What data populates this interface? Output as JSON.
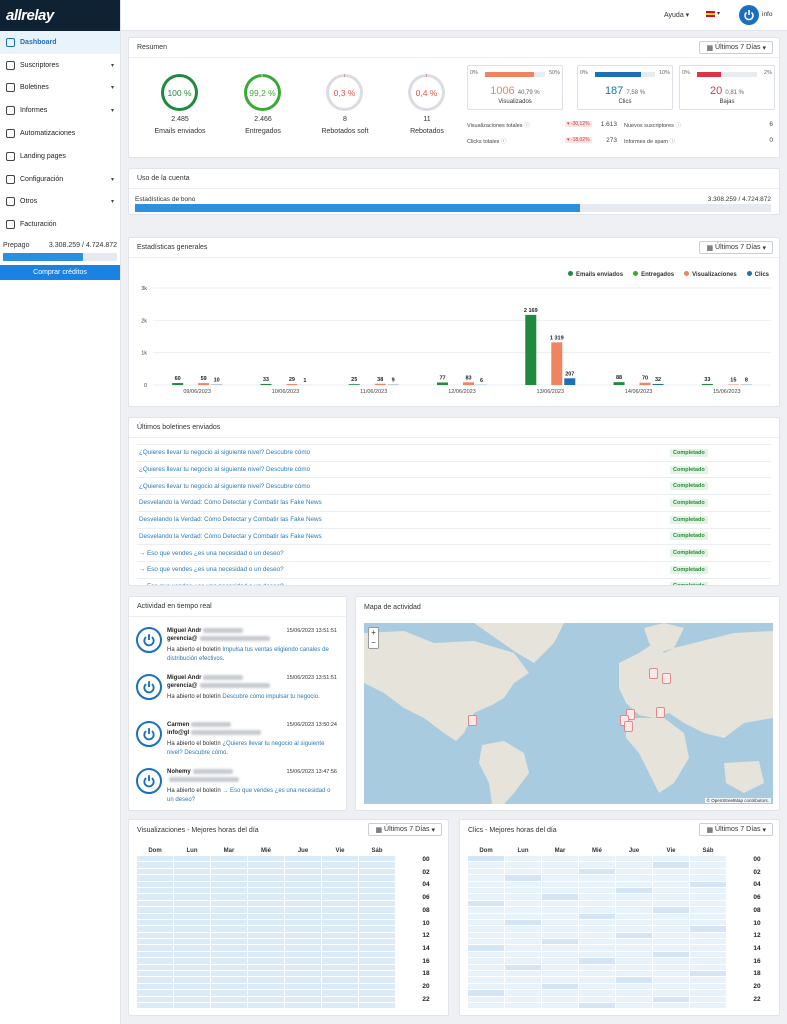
{
  "brand": {
    "logo_text": "allrelay"
  },
  "topbar": {
    "help": "Ayuda",
    "user": "info"
  },
  "sidebar": {
    "items": [
      {
        "label": "Dashboard",
        "icon": "grid-icon",
        "chevron": false,
        "active": true
      },
      {
        "label": "Suscriptores",
        "icon": "users-icon",
        "chevron": true
      },
      {
        "label": "Boletines",
        "icon": "mail-icon",
        "chevron": true
      },
      {
        "label": "Informes",
        "icon": "chart-icon",
        "chevron": true
      },
      {
        "label": "Automatizaciones",
        "icon": "automation-icon",
        "chevron": false
      },
      {
        "label": "Landing pages",
        "icon": "page-icon",
        "chevron": false
      },
      {
        "label": "Configuración",
        "icon": "gear-icon",
        "chevron": true
      },
      {
        "label": "Otros",
        "icon": "settings-icon",
        "chevron": true
      },
      {
        "label": "Facturación",
        "icon": "dollar-icon",
        "chevron": false
      }
    ],
    "prepago_label": "Prepago",
    "prepago_value": "3.308.259 / 4.724.872",
    "prepago_fraction": 0.7,
    "buy_label": "Comprar créditos"
  },
  "resumen": {
    "title": "Resumen",
    "period": "Últimos 7 Días",
    "rings": [
      {
        "value": "100 %",
        "count": "2.485",
        "label": "Emails enviados",
        "color": "#1f8a3b",
        "fraction": 1.0
      },
      {
        "value": "99,2 %",
        "count": "2.466",
        "label": "Entregados",
        "color": "#3aaa35",
        "fraction": 0.992
      },
      {
        "value": "0,3 %",
        "count": "8",
        "label": "Rebotados soft",
        "color": "#e0534a",
        "fraction": 0.003
      },
      {
        "value": "0,4 %",
        "count": "11",
        "label": "Rebotados",
        "color": "#e0534a",
        "fraction": 0.004
      }
    ],
    "boxes": [
      {
        "left": "0%",
        "right": "50%",
        "value": "1006",
        "pct": "40,79 %",
        "label": "Visualizados",
        "color": "#ef8460",
        "fill": 0.82,
        "text_color": "#ef8460"
      },
      {
        "left": "0%",
        "right": "10%",
        "value": "187",
        "pct": "7,58 %",
        "label": "Clics",
        "color": "#1f6fb5",
        "fill": 0.76,
        "text_color": "#1f6fb5"
      },
      {
        "left": "0%",
        "right": "2%",
        "value": "20",
        "pct": "0,81 %",
        "label": "Bajas",
        "color": "#d9364a",
        "fill": 0.4,
        "text_color": "#d9364a"
      }
    ],
    "stats": [
      {
        "label": "Visualizaciones totales",
        "delta": "-30,12%",
        "value": "1.613"
      },
      {
        "label": "Clicks totales",
        "delta": "-18,02%",
        "value": "273"
      }
    ],
    "stats_right": [
      {
        "label": "Nuevos suscriptores",
        "value": "6"
      },
      {
        "label": "Informes de spam",
        "value": "0"
      }
    ]
  },
  "uso": {
    "title": "Uso de la cuenta",
    "label": "Estadísticas de bono",
    "value": "3.308.259 / 4.724.872",
    "fraction": 0.7
  },
  "estadisticas": {
    "title": "Estadísticas generales",
    "period": "Últimos 7 Días"
  },
  "chart_data": {
    "type": "bar",
    "title": "",
    "ylim": [
      0,
      3000
    ],
    "yticks": [
      "0",
      "1k",
      "2k",
      "3k"
    ],
    "categories": [
      "09/06/2023",
      "10/06/2023",
      "11/06/2023",
      "12/06/2023",
      "13/06/2023",
      "14/06/2023",
      "15/06/2023"
    ],
    "series": [
      {
        "name": "Emails enviados",
        "color": "#1f8a3b",
        "values": [
          60,
          33,
          25,
          77,
          2169,
          88,
          33
        ],
        "labels": [
          "60",
          "33",
          "25",
          "77",
          "2 169",
          "88",
          "33"
        ]
      },
      {
        "name": "Entregados",
        "color": "#3aaa35",
        "values": [
          0,
          0,
          0,
          0,
          0,
          0,
          0
        ],
        "labels": [
          "",
          "",
          "",
          "",
          "",
          "",
          ""
        ]
      },
      {
        "name": "Visualizaciones",
        "color": "#ef8460",
        "values": [
          59,
          29,
          38,
          83,
          1319,
          70,
          15
        ],
        "labels": [
          "59",
          "29",
          "38",
          "83",
          "1 319",
          "70",
          "15"
        ]
      },
      {
        "name": "Clics",
        "color": "#1f6fb5",
        "values": [
          10,
          1,
          9,
          6,
          207,
          32,
          8
        ],
        "labels": [
          "10",
          "1",
          "9",
          "6",
          "207",
          "32",
          "8"
        ]
      }
    ],
    "legend": "top-right"
  },
  "boletines": {
    "title": "Últimos boletines enviados",
    "status": "Completado",
    "rows": [
      "¿Quieres llevar tu negocio al siguiente nivel? Descubre cómo",
      "¿Quieres llevar tu negocio al siguiente nivel? Descubre cómo",
      "¿Quieres llevar tu negocio al siguiente nivel? Descubre cómo",
      "Desvelando la Verdad: Cómo Detectar y Combatir las Fake News",
      "Desvelando la Verdad: Cómo Detectar y Combatir las Fake News",
      "Desvelando la Verdad: Cómo Detectar y Combatir las Fake News",
      "→ Eso que vendes ¿es una necesidad o un deseo?",
      "→ Eso que vendes ¿es una necesidad o un deseo?",
      "→ Eso que vendes ¿es una necesidad o un deseo?"
    ]
  },
  "actividad": {
    "title": "Actividad en tiempo real",
    "items": [
      {
        "name": "Miguel Andr",
        "date": "15/06/2023 13:51:51",
        "mail": "gerencia@",
        "pre": "Ha abierto el boletín ",
        "link": "Impulsa tus ventas eligiendo canales de distribución efectivos",
        "post": "."
      },
      {
        "name": "Miguel Andr",
        "date": "15/06/2023 13:51:51",
        "mail": "gerencia@",
        "pre": "Ha abierto el boletín ",
        "link": "Descubre cómo impulsar tu negocio",
        "post": "."
      },
      {
        "name": "Carmen",
        "date": "15/06/2023 13:50:24",
        "mail": "info@gl",
        "pre": "Ha abierto el boletín ",
        "link": "¿Quieres llevar tu negocio al siguiente nivel? Descubre cómo",
        "post": "."
      },
      {
        "name": "Nohemy",
        "date": "15/06/2023 13:47:56",
        "mail": "",
        "pre": "Ha abierto el boletín ",
        "link": "→ Eso que vendes ¿es una necesidad o un deseo?",
        "post": ""
      }
    ]
  },
  "mapa": {
    "title": "Mapa de actividad",
    "zoom_in": "+",
    "zoom_out": "−",
    "attribution": "© OpenStreetMap contributors."
  },
  "heat_vis": {
    "title": "Visualizaciones - Mejores horas del día",
    "period": "Últimos 7 Días"
  },
  "heat_clics": {
    "title": "Clics - Mejores horas del día",
    "period": "Últimos 7 Días"
  },
  "days": [
    "Dom",
    "Lun",
    "Mar",
    "Mié",
    "Jue",
    "Vie",
    "Sáb"
  ],
  "hours": [
    "00",
    "02",
    "04",
    "06",
    "08",
    "10",
    "12",
    "14",
    "16",
    "18",
    "20",
    "22"
  ]
}
